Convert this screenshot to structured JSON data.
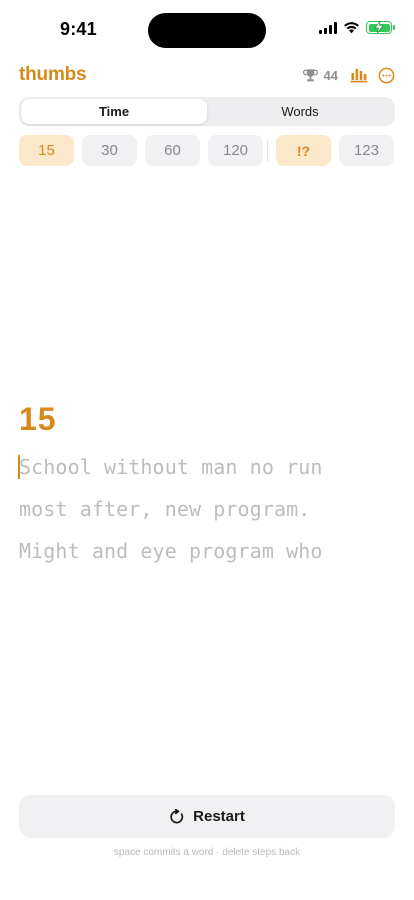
{
  "status_bar": {
    "time": "9:41"
  },
  "header": {
    "title": "thumbs",
    "trophy_count": "44",
    "icons": [
      "trophy-icon",
      "stats-icon",
      "more-icon"
    ]
  },
  "mode_tabs": [
    {
      "label": "Time",
      "active": true
    },
    {
      "label": "Words",
      "active": false
    }
  ],
  "options": {
    "durations": [
      {
        "label": "15",
        "active": true
      },
      {
        "label": "30",
        "active": false
      },
      {
        "label": "60",
        "active": false
      },
      {
        "label": "120",
        "active": false
      }
    ],
    "punctuation": {
      "label": "!?",
      "active": true
    },
    "numbers": {
      "label": "123",
      "active": false
    }
  },
  "test": {
    "timer": "15",
    "lines": [
      "School without man no run",
      "most after, new program.",
      "Might and eye program who"
    ]
  },
  "restart": {
    "label": "Restart"
  },
  "hint": "space commits a word · delete steps back",
  "colors": {
    "accent": "#d68a1c",
    "accent_bg": "#fbe7c9",
    "chip_bg": "#f1f1f4",
    "pending_text": "#bdbdc0",
    "battery": "#34c759"
  }
}
